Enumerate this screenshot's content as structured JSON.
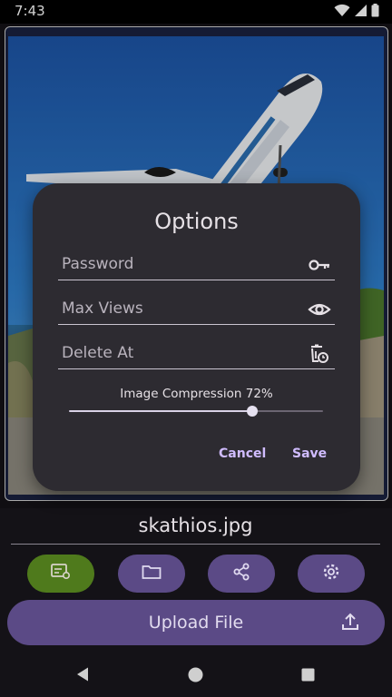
{
  "status_bar": {
    "time": "7:43",
    "icons": [
      "wifi-icon",
      "signal-icon",
      "battery-icon"
    ]
  },
  "dialog": {
    "title": "Options",
    "fields": [
      {
        "name": "password",
        "placeholder": "Password",
        "icon": "key-icon"
      },
      {
        "name": "max-views",
        "placeholder": "Max Views",
        "icon": "eye-icon"
      },
      {
        "name": "delete-at",
        "placeholder": "Delete At",
        "icon": "delete-clock-icon"
      }
    ],
    "compression": {
      "label": "Image Compression 72%",
      "value": 0.72
    },
    "cancel_label": "Cancel",
    "save_label": "Save"
  },
  "file": {
    "name": "skathios.jpg"
  },
  "actions": [
    {
      "name": "image-options-button",
      "icon": "image-settings-icon",
      "selected": true
    },
    {
      "name": "open-folder-button",
      "icon": "folder-icon",
      "selected": false
    },
    {
      "name": "share-button",
      "icon": "share-icon",
      "selected": false
    },
    {
      "name": "settings-button",
      "icon": "gear-icon",
      "selected": false
    }
  ],
  "upload": {
    "label": "Upload File",
    "icon": "upload-icon"
  },
  "nav": [
    "back-icon",
    "home-icon",
    "recents-icon"
  ],
  "colors": {
    "accent": "#d0bcff",
    "selected_action": "#4f7a1c",
    "action_button": "#5b4a86",
    "dialog_surface": "#2d2b31"
  }
}
